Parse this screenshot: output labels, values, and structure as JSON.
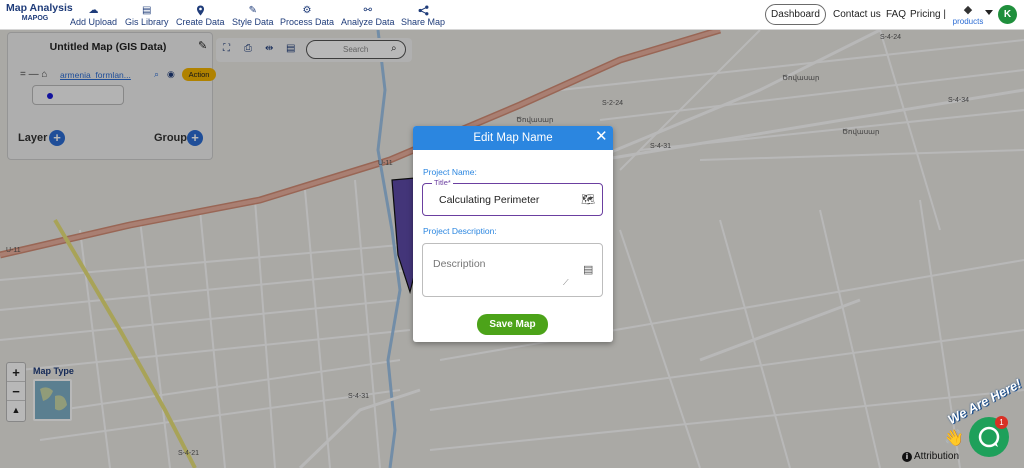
{
  "app": {
    "logo_line1": "Map Analysis",
    "logo_line2": "MAPOG"
  },
  "nav": [
    {
      "label": "Add Upload",
      "icon": "cloud-upload-icon"
    },
    {
      "label": "Gis Library",
      "icon": "library-icon"
    },
    {
      "label": "Create Data",
      "icon": "map-pin-icon"
    },
    {
      "label": "Style Data",
      "icon": "paint-icon"
    },
    {
      "label": "Process Data",
      "icon": "process-icon"
    },
    {
      "label": "Analyze Data",
      "icon": "analyze-icon"
    },
    {
      "label": "Share Map",
      "icon": "share-icon"
    }
  ],
  "top_right": {
    "dashboard": "Dashboard",
    "contact": "Contact us",
    "faq": "FAQ",
    "pricing": "Pricing |",
    "products": "products",
    "avatar_initial": "K"
  },
  "left_panel": {
    "title": "Untitled Map (GIS Data)",
    "layer_name": "armenia_formlan...",
    "action_label": "Action",
    "layer_label": "Layer",
    "group_label": "Group"
  },
  "map_tools": {
    "search_placeholder": "Search"
  },
  "map": {
    "labels": [
      "U-11",
      "U-11",
      "U-11",
      "S-2-24",
      "S-4-24",
      "S-4-34",
      "S-4-31",
      "S-4-31",
      "S-4-21",
      "Ծովասար",
      "Ծովասար",
      "Ծովասար"
    ],
    "map_type_label": "Map Type",
    "attribution": "Attribution"
  },
  "chat": {
    "we_are_here": "We Are Here!",
    "badge_count": "1"
  },
  "modal": {
    "title": "Edit Map Name",
    "project_name_label": "Project Name:",
    "title_field_label": "Title*",
    "title_value": "Calculating Perimeter",
    "project_description_label": "Project Description:",
    "description_placeholder": "Description",
    "save_label": "Save Map"
  },
  "colors": {
    "brand_blue": "#1f3c7a",
    "modal_header": "#2b86e0",
    "save_green": "#4ca319",
    "action_yellow": "#f4b400",
    "title_border": "#6b3fa0",
    "highway": "#e8a08a",
    "river": "#9ec4e8"
  }
}
